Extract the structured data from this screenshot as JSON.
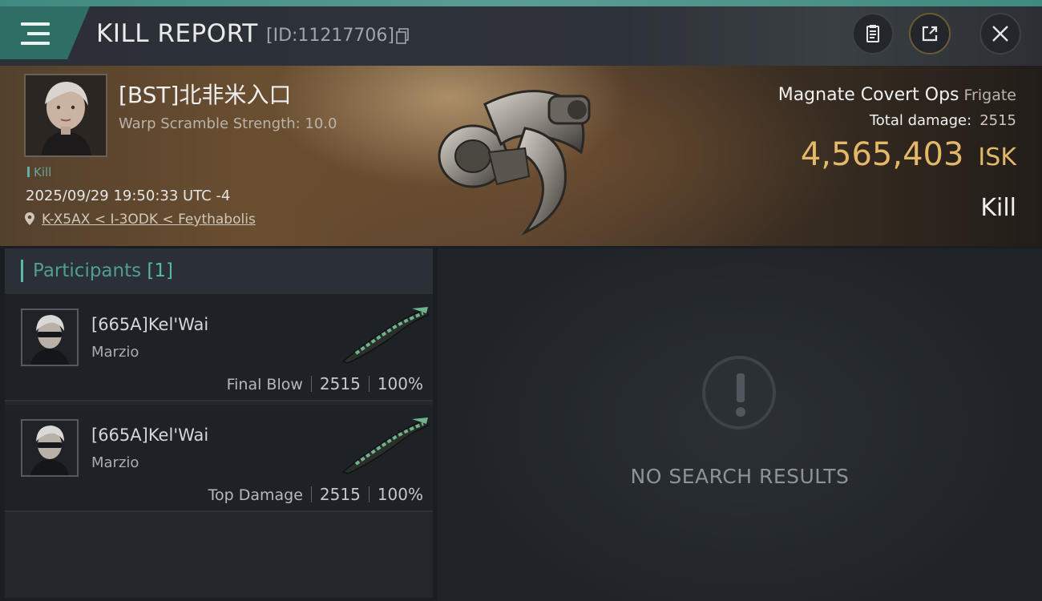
{
  "header": {
    "title": "KILL REPORT",
    "id_text": "[ID:11217706]",
    "buttons": [
      "menu-icon",
      "clipboard-icon",
      "share-icon",
      "close-icon"
    ]
  },
  "victim": {
    "name": "[BST]北非米入口",
    "warp_scramble": "Warp Scramble Strength: 10.0",
    "tag": "Kill",
    "datetime": "2025/09/29 19:50:33 UTC -4",
    "location": "K-X5AX < I-3ODK < Feythabolis"
  },
  "ship": {
    "name": "Magnate Covert Ops",
    "class": "Frigate",
    "total_damage_label": "Total damage:",
    "total_damage_value": "2515",
    "isk_amount": "4,565,403",
    "isk_unit": "ISK",
    "result": "Kill"
  },
  "participants": {
    "label": "Participants",
    "count": "[1]",
    "rows": [
      {
        "name": "[665A]Kel'Wai",
        "ship": "Marzio",
        "role": "Final Blow",
        "damage": "2515",
        "percent": "100%"
      },
      {
        "name": "[665A]Kel'Wai",
        "ship": "Marzio",
        "role": "Top Damage",
        "damage": "2515",
        "percent": "100%"
      }
    ]
  },
  "right_panel": {
    "empty_text": "NO SEARCH RESULTS",
    "icon": "exclamation-icon"
  },
  "colors": {
    "accent_teal": "#5ab7aa",
    "isk_gold": "#e3b868",
    "menu_bg": "#2e6e64"
  }
}
